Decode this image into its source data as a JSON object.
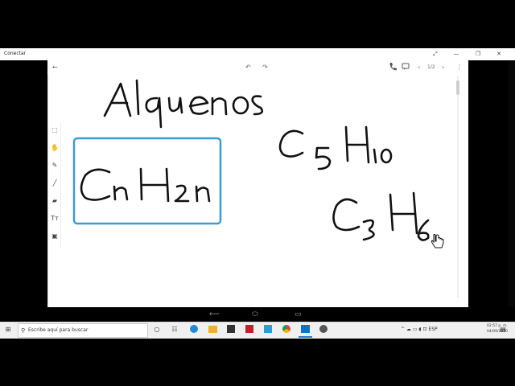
{
  "window": {
    "title": "Conectar",
    "controls": [
      "⤢",
      "—",
      "❐",
      "✕"
    ]
  },
  "toolbar": {
    "back_icon": "←",
    "undo_icon": "↶",
    "redo_icon": "↷",
    "page_counter": "1/2",
    "prev_page_icon": "‹",
    "next_page_icon": "›",
    "more_icon": "⋮"
  },
  "left_tools": {
    "items": [
      "select",
      "touch",
      "pen",
      "line",
      "eraser",
      "text",
      "image"
    ],
    "icons": [
      "⬚",
      "✋",
      "✎",
      "╱",
      "▰",
      "Tт",
      "▣"
    ]
  },
  "whiteboard": {
    "title_text": "Alquenos",
    "formula_boxed": "CnH2n",
    "formula_pentene": "C5H10",
    "formula_propene": "C3H6",
    "box_color": "#3b9bd6",
    "ink_color": "#111111"
  },
  "nav_bar": {
    "back": "⟵",
    "home": "⬭",
    "recents": "▭"
  },
  "taskbar": {
    "start_icon": "⊞",
    "search_icon": "⚲",
    "search_placeholder": "Escribe aquí para buscar",
    "tray_icons": "^ ☁ ▭ ◖ ⊡ ESP",
    "time": "02:57 p. m.",
    "date": "04/09/2020"
  }
}
